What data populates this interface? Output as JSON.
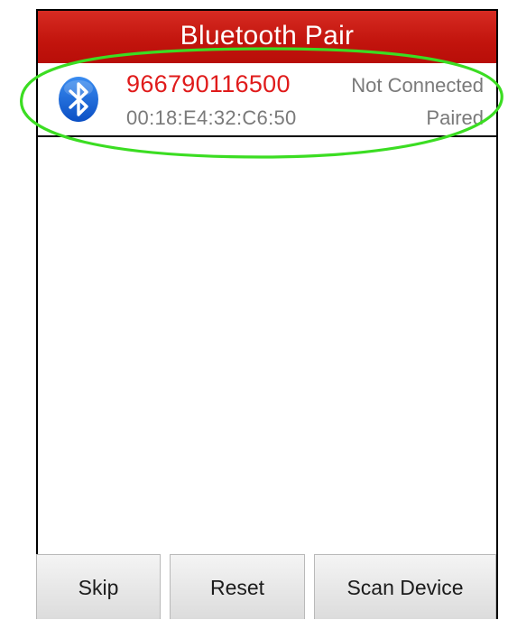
{
  "app": {
    "title": "Bluetooth Pair"
  },
  "device": {
    "icon": "bluetooth-icon",
    "name": "966790116500",
    "status": "Not Connected",
    "address": "00:18:E4:32:C6:50",
    "pair_state": "Paired"
  },
  "buttons": {
    "skip": "Skip",
    "reset": "Reset",
    "scan": "Scan Device"
  },
  "colors": {
    "title_bar": "#c2140d",
    "device_name": "#e01b1b",
    "secondary_text": "#7a7a7a",
    "highlight_annotation": "#3bdd22"
  }
}
